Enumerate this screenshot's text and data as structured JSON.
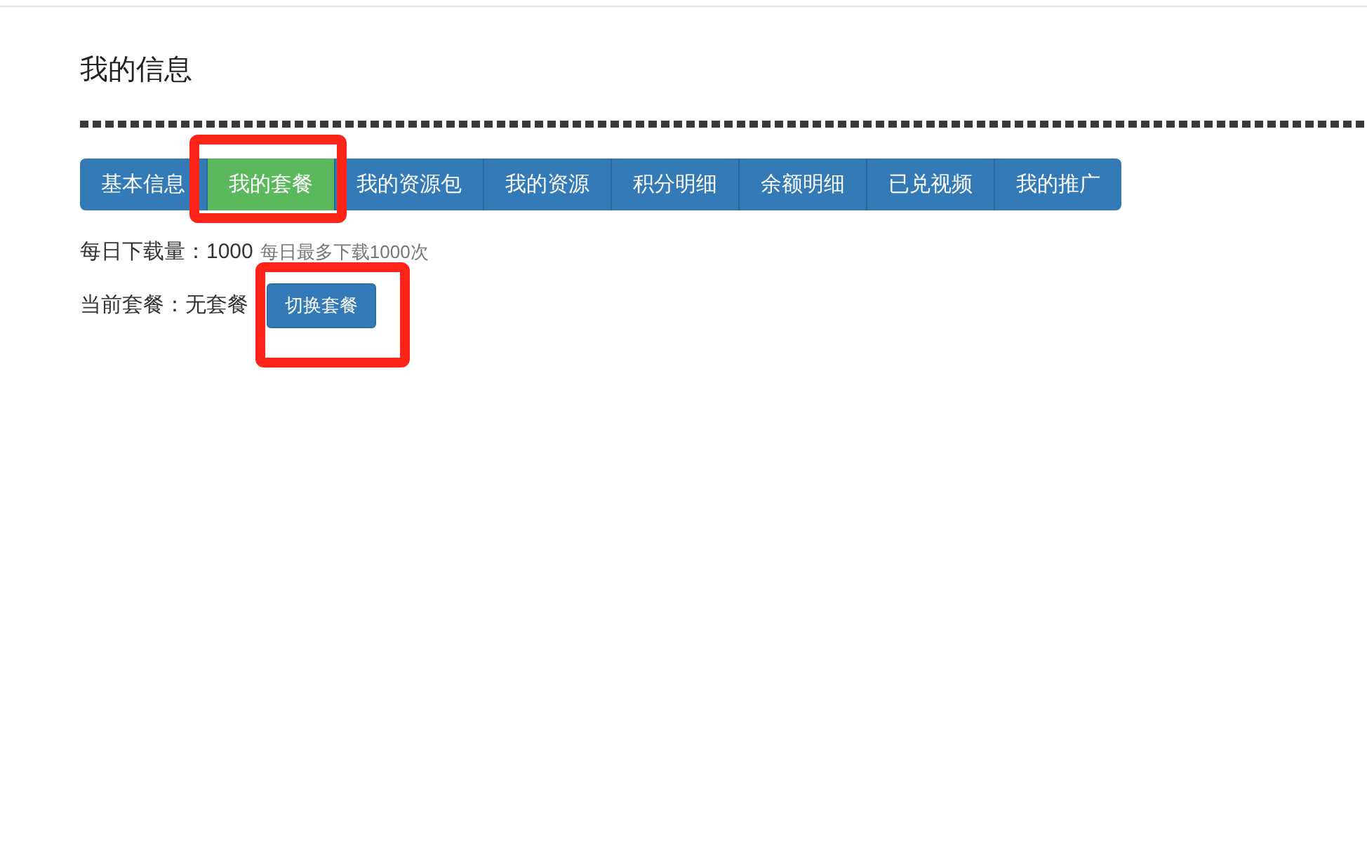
{
  "page": {
    "title": "我的信息"
  },
  "tabs": [
    {
      "label": "基本信息",
      "selected": false,
      "highlighted": false
    },
    {
      "label": "我的套餐",
      "selected": true,
      "highlighted": true
    },
    {
      "label": "我的资源包",
      "selected": false,
      "highlighted": false
    },
    {
      "label": "我的资源",
      "selected": false,
      "highlighted": false
    },
    {
      "label": "积分明细",
      "selected": false,
      "highlighted": false
    },
    {
      "label": "余额明细",
      "selected": false,
      "highlighted": false
    },
    {
      "label": "已兑视频",
      "selected": false,
      "highlighted": false
    },
    {
      "label": "我的推广",
      "selected": false,
      "highlighted": false
    }
  ],
  "download": {
    "text": "每日下载量：1000",
    "hint": "每日最多下载1000次"
  },
  "plan": {
    "text": "当前套餐：无套餐",
    "button": {
      "label": "切换套餐",
      "highlighted": true
    }
  }
}
